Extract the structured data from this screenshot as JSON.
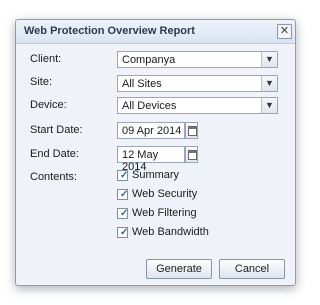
{
  "dialog": {
    "title": "Web Protection Overview Report",
    "close_symbol": "✕"
  },
  "form": {
    "client": {
      "label": "Client:",
      "value": "Companya"
    },
    "site": {
      "label": "Site:",
      "value": "All Sites"
    },
    "device": {
      "label": "Device:",
      "value": "All Devices"
    },
    "start_date": {
      "label": "Start Date:",
      "value": "09 Apr 2014"
    },
    "end_date": {
      "label": "End Date:",
      "value": "12 May 2014"
    },
    "contents": {
      "label": "Contents:",
      "items": [
        {
          "label": "Summary",
          "checked": true
        },
        {
          "label": "Web Security",
          "checked": true
        },
        {
          "label": "Web Filtering",
          "checked": true
        },
        {
          "label": "Web Bandwidth",
          "checked": true
        }
      ]
    }
  },
  "buttons": {
    "generate": "Generate",
    "cancel": "Cancel"
  },
  "icons": {
    "dropdown": "chevron-down-icon",
    "calendar": "calendar-icon",
    "close": "close-icon",
    "check": "checkmark-icon"
  },
  "colors": {
    "dialog_bg": "#eff3f9",
    "title_text": "#2b3a4f",
    "check_color": "#2c64b3"
  }
}
